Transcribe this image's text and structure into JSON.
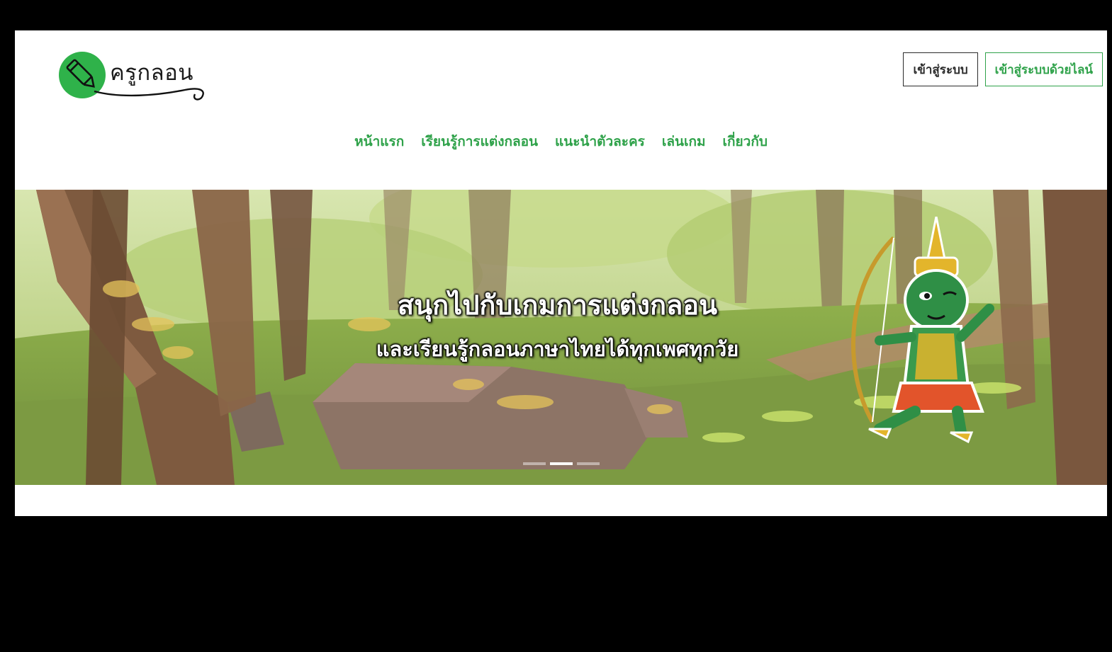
{
  "logo": {
    "text": "ครูกลอน",
    "icon": "pencil-icon",
    "color": "#2fb24a"
  },
  "auth": {
    "login_label": "เข้าสู่ระบบ",
    "line_login_label": "เข้าสู่ระบบด้วยไลน์"
  },
  "nav": {
    "items": [
      {
        "label": "หน้าแรก"
      },
      {
        "label": "เรียนรู้การแต่งกลอน"
      },
      {
        "label": "แนะนำตัวละคร"
      },
      {
        "label": "เล่นเกม"
      },
      {
        "label": "เกี่ยวกับ"
      }
    ]
  },
  "hero": {
    "title": "สนุกไปกับเกมการแต่งกลอน",
    "subtitle": "และเรียนรู้กลอนภาษาไทยได้ทุกเพศทุกวัย",
    "slides": 3,
    "active_slide": 2
  },
  "colors": {
    "accent": "#2fa24a",
    "text": "#2b2b2b"
  }
}
